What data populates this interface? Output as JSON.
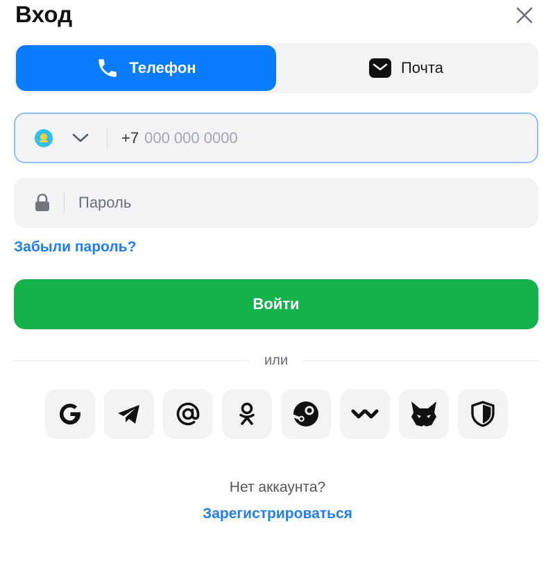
{
  "header": {
    "title": "Вход",
    "close_icon": "close-icon"
  },
  "tabs": [
    {
      "label": "Телефон",
      "icon": "phone-icon",
      "active": true
    },
    {
      "label": "Почта",
      "icon": "mail-icon",
      "active": false
    }
  ],
  "phone": {
    "country_flag": "kazakhstan-flag-icon",
    "prefix": "+7",
    "placeholder": "000 000 0000",
    "value": ""
  },
  "password": {
    "placeholder": "Пароль",
    "value": "",
    "icon": "lock-icon"
  },
  "forgot_link": "Забыли пароль?",
  "login_button": "Войти",
  "separator": "или",
  "social_logins": [
    {
      "name": "google",
      "icon": "google-icon"
    },
    {
      "name": "telegram",
      "icon": "telegram-icon"
    },
    {
      "name": "mail",
      "icon": "at-sign-icon"
    },
    {
      "name": "odnoklassniki",
      "icon": "odnoklassniki-icon"
    },
    {
      "name": "steam",
      "icon": "steam-icon"
    },
    {
      "name": "walletconnect",
      "icon": "walletconnect-icon"
    },
    {
      "name": "metamask",
      "icon": "fox-icon"
    },
    {
      "name": "shield",
      "icon": "shield-icon"
    }
  ],
  "footer": {
    "no_account": "Нет аккаунта?",
    "register": "Зарегистрироваться"
  },
  "colors": {
    "primary": "#0a7cff",
    "success": "#14b24b",
    "link": "#1f7ef0",
    "field_bg": "#f2f3f5",
    "focus_border": "#8fc0f2"
  }
}
